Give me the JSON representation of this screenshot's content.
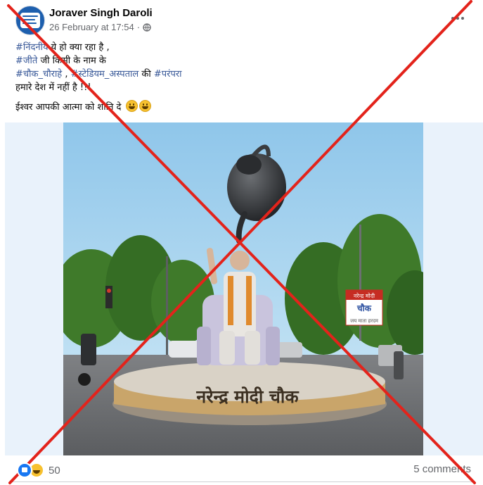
{
  "post": {
    "author_name": "Joraver Singh Daroli",
    "timestamp": "26 February at 17:54",
    "separator": "·",
    "privacy_icon": "globe-icon",
    "more_icon": "more-options-icon",
    "text": {
      "line1_tag": "#निंदनीय",
      "line1_rest": " ये हो क्या रहा है ,",
      "line2_tag": "#जीते",
      "line2_rest": " जी किसी के नाम के",
      "line3_tag1": "#चौक_चौराहे",
      "line3_sep": " , ",
      "line3_tag2": "#स्टेडियम_अस्पताल",
      "line3_mid": " की ",
      "line3_tag3": "#परंपरा",
      "line4": "हमारे देश में नहीं है !!!",
      "line5": "ईश्वर आपकी आत्मा को शांति दे"
    },
    "image": {
      "main_sign": "नरेन्द्र मोदी चौक",
      "roadside_sign_top": "नरेन्द्र मोदी",
      "roadside_sign_mid": "चौक",
      "roadside_sign_bottom": "जय माता हरदम"
    }
  },
  "footer": {
    "reaction_icons": [
      "like-icon",
      "haha-icon"
    ],
    "reaction_count": "50",
    "comments_label": "5 comments"
  },
  "colors": {
    "hashtag": "#385898",
    "meta_text": "#65676b",
    "cross": "#e3231b",
    "like_blue": "#1877f2"
  }
}
